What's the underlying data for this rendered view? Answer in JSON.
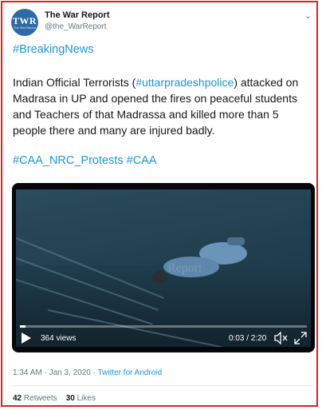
{
  "account": {
    "avatar_text": "TWR",
    "avatar_subtext": "The War Report",
    "name": "The War Report",
    "handle": "@the_WarReport"
  },
  "tweet": {
    "heading_hashtag": "#BreakingNews",
    "body_part1": "Indian Official Terrorists (",
    "body_link": "#uttarpradeshpolice",
    "body_part2": ") attacked on Madrasa in UP and opened the fires on peaceful students and Teachers of that Madrassa  and killed more than 5 people there and many are injured badly.",
    "tags": "#CAA_NRC_Protests #CAA"
  },
  "video": {
    "views": "364 views",
    "time": "0:03 / 2:20",
    "watermark": "Report",
    "progress": 0.02
  },
  "meta": {
    "timestamp": "1:34 AM · Jan 3, 2020 · ",
    "app": "Twitter for Android"
  },
  "stats": {
    "retweets_count": "42",
    "retweets_label": "Retweets",
    "likes_count": "30",
    "likes_label": "Likes"
  },
  "icons": [
    "chevron-down-icon",
    "play-icon",
    "mute-icon",
    "fullscreen-icon"
  ]
}
